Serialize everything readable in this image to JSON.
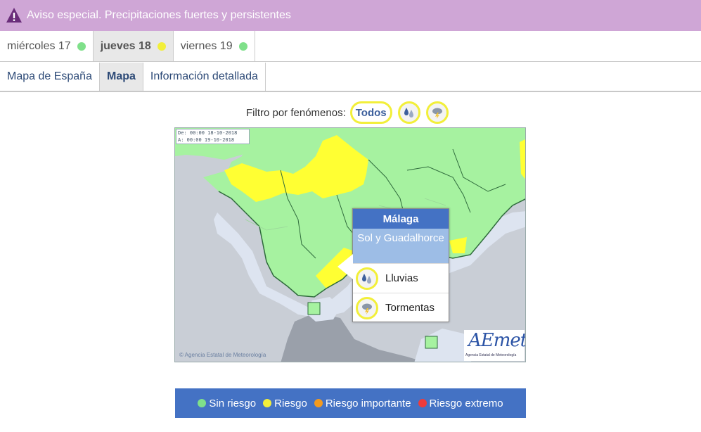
{
  "banner": {
    "text": "Aviso especial. Precipitaciones fuertes y persistentes",
    "color": "#cfa6d6"
  },
  "days": [
    {
      "label": "miércoles 17",
      "status": "sin-riesgo",
      "dot_color": "#7fe08a",
      "active": false
    },
    {
      "label": "jueves 18",
      "status": "riesgo",
      "dot_color": "#f2ef3a",
      "active": true
    },
    {
      "label": "viernes 19",
      "status": "sin-riesgo",
      "dot_color": "#7fe08a",
      "active": false
    }
  ],
  "tabs": [
    {
      "label": "Mapa de España",
      "active": false
    },
    {
      "label": "Mapa",
      "active": true
    },
    {
      "label": "Información detallada",
      "active": false
    }
  ],
  "filter": {
    "label": "Filtro por fenómenos:",
    "all_label": "Todos",
    "icons": [
      "rain-icon",
      "thunderstorm-icon"
    ]
  },
  "map": {
    "date_from": "De: 00:00 18-10-2018",
    "date_to": "A:  00:00 19-10-2018",
    "copyright": "© Agencia Estatal de Meteorología",
    "logo": "AEmet",
    "logo_sub": "Agencia Estatal de Meteorología",
    "colors": {
      "sin_riesgo": "#a6f2a0",
      "riesgo": "#ffff33",
      "sea": "#c9ced6",
      "coast": "#dde4f0"
    }
  },
  "popup": {
    "province": "Málaga",
    "zone": "Sol y Guadalhorce",
    "phenomena": [
      {
        "label": "Lluvias",
        "icon": "rain-icon"
      },
      {
        "label": "Tormentas",
        "icon": "thunderstorm-icon"
      }
    ]
  },
  "legend": [
    {
      "label": "Sin riesgo",
      "color": "#7fe08a"
    },
    {
      "label": "Riesgo",
      "color": "#f2ef3a"
    },
    {
      "label": "Riesgo importante",
      "color": "#f39a1e"
    },
    {
      "label": "Riesgo extremo",
      "color": "#ef3b3b"
    }
  ]
}
